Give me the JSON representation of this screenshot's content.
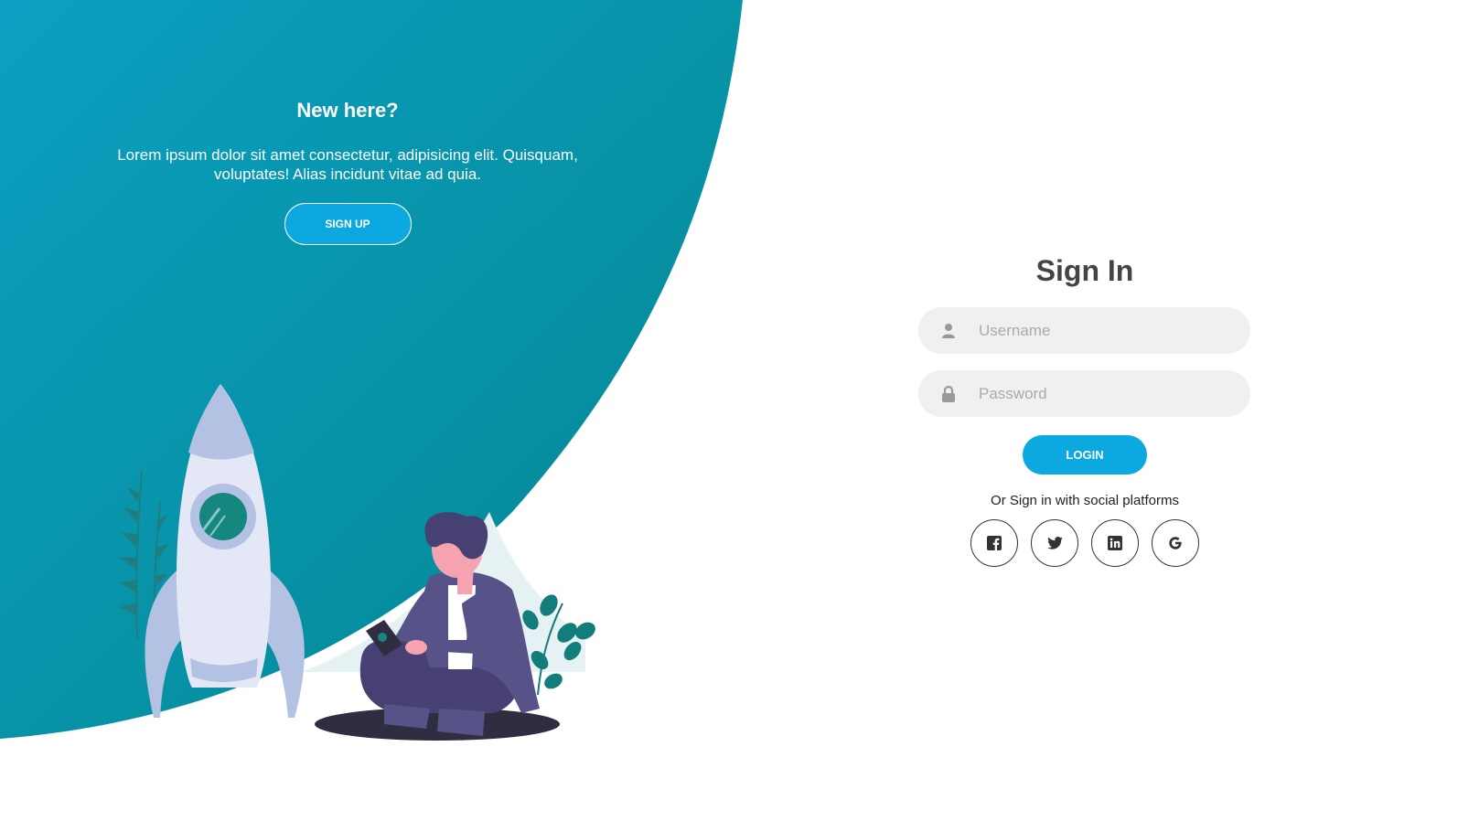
{
  "colors": {
    "teal_dark": "#068c99",
    "teal_light": "#0b9fbd",
    "accent": "#0ca8e0",
    "input_bg": "#f0f0f0",
    "title": "#444444"
  },
  "panel": {
    "title": "New here?",
    "description": "Lorem ipsum dolor sit amet consectetur, adipisicing elit. Quisquam, voluptates! Alias incidunt vitae ad quia.",
    "signup_label": "SIGN UP"
  },
  "signin": {
    "title": "Sign In",
    "username_placeholder": "Username",
    "password_placeholder": "Password",
    "login_label": "LOGIN",
    "social_text": "Or Sign in with social platforms",
    "social": [
      {
        "icon": "facebook-icon"
      },
      {
        "icon": "twitter-icon"
      },
      {
        "icon": "linkedin-icon"
      },
      {
        "icon": "google-icon"
      }
    ]
  }
}
